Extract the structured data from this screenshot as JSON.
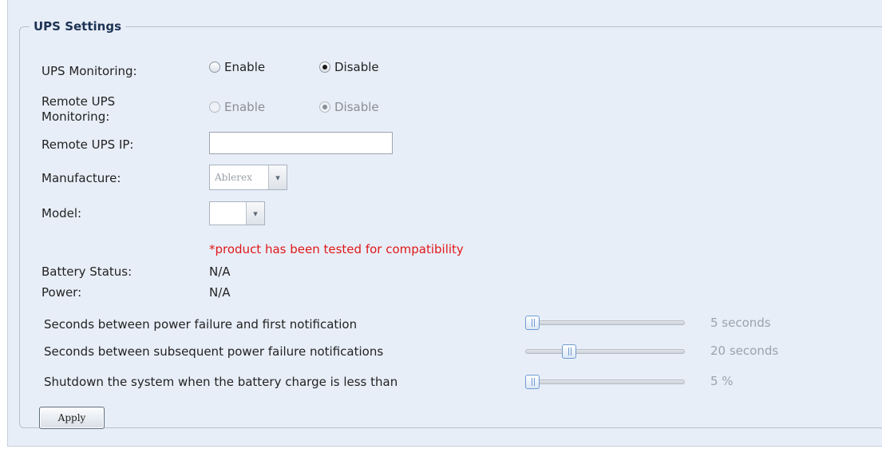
{
  "section_title": "UPS Settings",
  "ups_monitoring": {
    "label": "UPS Monitoring:",
    "options": [
      "Enable",
      "Disable"
    ],
    "selected": "Disable"
  },
  "remote_ups_monitoring": {
    "label_line1": "Remote UPS",
    "label_line2": "Monitoring:",
    "options": [
      "Enable",
      "Disable"
    ],
    "selected": "Disable",
    "disabled": true
  },
  "remote_ups_ip": {
    "label": "Remote UPS IP:",
    "value": ""
  },
  "manufacture": {
    "label": "Manufacture:",
    "value": "Ablerex"
  },
  "model": {
    "label": "Model:",
    "value": ""
  },
  "compat_note": "*product has been tested for compatibility",
  "battery_status": {
    "label": "Battery Status:",
    "value": "N/A"
  },
  "power": {
    "label": "Power:",
    "value": "N/A"
  },
  "sliders": [
    {
      "label": "Seconds between power failure and first notification",
      "value_text": "5 seconds",
      "level": 0.0
    },
    {
      "label": "Seconds between subsequent power failure notifications",
      "value_text": "20 seconds",
      "level": 0.25
    },
    {
      "label": "Shutdown the system when the battery charge is less than",
      "value_text": "5 %",
      "level": 0.0
    }
  ],
  "apply_label": "Apply",
  "colors": {
    "panel_bg": "#e8eef8",
    "note_red": "#e01818",
    "legend_text": "#1d3354",
    "slider_handle_border": "#6f9bd0"
  }
}
